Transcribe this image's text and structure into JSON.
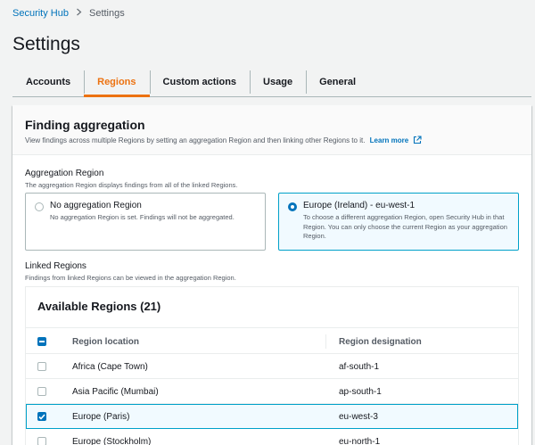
{
  "breadcrumb": {
    "parent": "Security Hub",
    "current": "Settings"
  },
  "page": {
    "title": "Settings"
  },
  "tabs": [
    {
      "label": "Accounts",
      "active": false
    },
    {
      "label": "Regions",
      "active": true
    },
    {
      "label": "Custom actions",
      "active": false
    },
    {
      "label": "Usage",
      "active": false
    },
    {
      "label": "General",
      "active": false
    }
  ],
  "finding_aggregation": {
    "title": "Finding aggregation",
    "description": "View findings across multiple Regions by setting an aggregation Region and then linking other Regions to it.",
    "learn_more": "Learn more"
  },
  "aggregation_region": {
    "label": "Aggregation Region",
    "description": "The aggregation Region displays findings from all of the linked Regions.",
    "options": [
      {
        "title": "No aggregation Region",
        "description": "No aggregation Region is set. Findings will not be aggregated.",
        "selected": false
      },
      {
        "title": "Europe (Ireland) - eu-west-1",
        "description": "To choose a different aggregation Region, open Security Hub in that Region. You can only choose the current Region as your aggregation Region.",
        "selected": true
      }
    ]
  },
  "linked_regions": {
    "label": "Linked Regions",
    "description": "Findings from linked Regions can be viewed in the aggregation Region."
  },
  "table": {
    "title": "Available Regions (21)",
    "columns": [
      "Region location",
      "Region designation"
    ],
    "rows": [
      {
        "location": "Africa (Cape Town)",
        "designation": "af-south-1",
        "checked": false
      },
      {
        "location": "Asia Pacific (Mumbai)",
        "designation": "ap-south-1",
        "checked": false
      },
      {
        "location": "Europe (Paris)",
        "designation": "eu-west-3",
        "checked": true
      },
      {
        "location": "Europe (Stockholm)",
        "designation": "eu-north-1",
        "checked": false
      }
    ]
  },
  "colors": {
    "accent": "#ec7211",
    "link": "#0073bb",
    "selected_bg": "#f1faff",
    "selected_border": "#00a1c9"
  }
}
